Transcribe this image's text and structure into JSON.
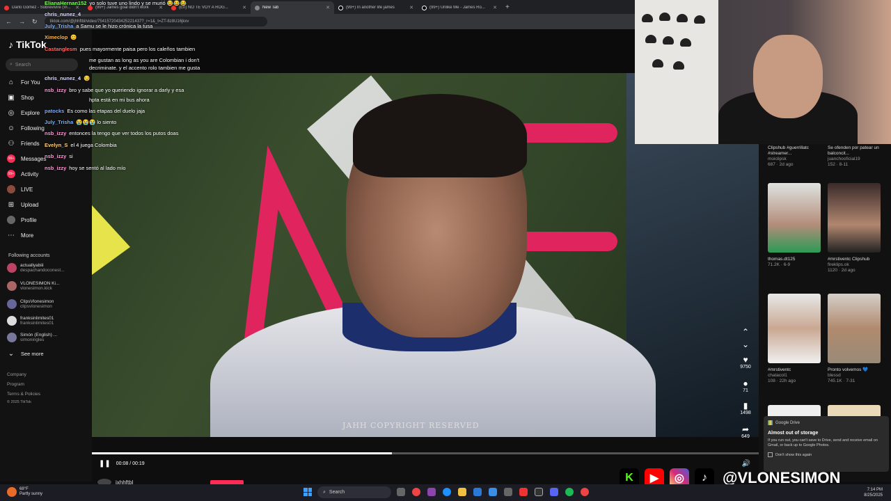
{
  "browser": {
    "tabs": [
      {
        "title": "Darlo Gómez - Sobrevivire (Vi...",
        "active": false
      },
      {
        "title": "(99+) James goal didn't work",
        "active": false
      },
      {
        "title": "(En) NO TE VOY A ROG...",
        "active": false
      },
      {
        "title": "New Tab",
        "active": true
      },
      {
        "title": "(99+) In another life james",
        "active": false
      },
      {
        "title": "(99+) Unlike Me - James Ro...",
        "active": false
      }
    ],
    "url": "tiktok.com/@jhhftbl/video/7541572043425221437?_r=1&_t=ZT-8z8U16jkxv"
  },
  "tiktok": {
    "logo": "TikTok",
    "search_placeholder": "Search",
    "nav": [
      {
        "label": "For You",
        "icon": "home-icon"
      },
      {
        "label": "Shop",
        "icon": "shop-icon"
      },
      {
        "label": "Explore",
        "icon": "compass-icon"
      },
      {
        "label": "Following",
        "icon": "following-icon"
      },
      {
        "label": "Friends",
        "icon": "friends-icon"
      },
      {
        "label": "Messages",
        "icon": "messages-icon",
        "badge": "99+"
      },
      {
        "label": "Activity",
        "icon": "activity-icon",
        "badge": "99+"
      },
      {
        "label": "LIVE",
        "icon": "live-icon"
      },
      {
        "label": "Upload",
        "icon": "upload-icon"
      },
      {
        "label": "Profile",
        "icon": "profile-icon"
      },
      {
        "label": "More",
        "icon": "more-icon"
      }
    ],
    "following_header": "Following accounts",
    "following": [
      {
        "name": "actuallyabiii",
        "handle": "despachandoconest..."
      },
      {
        "name": "VLONESIMON Ki...",
        "handle": "vlonesimon.kick"
      },
      {
        "name": "ClipsVlonesimon",
        "handle": "clipsvlonesimon"
      },
      {
        "name": "franksinlimites01",
        "handle": "franksinlimites01"
      },
      {
        "name": "Simón (English) ...",
        "handle": "simoningles"
      }
    ],
    "see_more": "See more",
    "footer": [
      "Company",
      "Program",
      "Terms & Policies",
      "© 2025 TikTok"
    ],
    "video": {
      "watermark": "JAHH COPYRIGHT RESERVED",
      "time": "00:08 / 00:19",
      "progress": 0.45,
      "author": "jxhhftbl"
    },
    "actions": [
      {
        "icon": "heart-icon",
        "count": "9750"
      },
      {
        "icon": "comment-icon",
        "count": "71"
      },
      {
        "icon": "bookmark-icon",
        "count": "1498"
      },
      {
        "icon": "share-icon",
        "count": "649"
      }
    ],
    "recommendations": [
      {
        "title": "Clipshub #guerrillatc #streamer...",
        "user": "moiclipsk",
        "stats": "687 · 2d ago"
      },
      {
        "title": "Se ofenden por patear un balconcit...",
        "user": "juanchooficial19",
        "stats": "152 · 8-11"
      },
      {
        "title": "thomas.dt125",
        "user": "",
        "stats": "71.2K · 6-9"
      },
      {
        "title": "#mrstiventc Clipshub",
        "user": "fireklips.ok",
        "stats": "1120 · 2d ago"
      },
      {
        "title": "#mrstiventc",
        "user": "chatacol1",
        "stats": "108 · 22h ago"
      },
      {
        "title": "Pronto volvemos 💙",
        "user": "blessd",
        "stats": "745.1K · 7-31"
      }
    ]
  },
  "chat": [
    {
      "user": "ElianaHernan152",
      "color": "#7fff5a",
      "text": "yo solo tuve uno lindo y se murió 😂😂😂"
    },
    {
      "user": "chris_nunez_4",
      "color": "#d9d9ff",
      "text": ""
    },
    {
      "user": "July_Trisha",
      "color": "#6fb2ff",
      "text": "a Samu se le hizo crónica la tusa"
    },
    {
      "user": "Ximeclop",
      "color": "#ffb347",
      "text": "😊"
    },
    {
      "user": "Castanglesm",
      "color": "#ff6b6b",
      "text": "pues mayormente paisa pero los caleños tambien"
    },
    {
      "user": "",
      "color": "#fff",
      "text": "me gustan as long as you are Colombian i don't"
    },
    {
      "user": "",
      "color": "#fff",
      "text": "decriminate. y el accento rolo tambien me gusta"
    },
    {
      "user": "chris_nunez_4",
      "color": "#d9d9ff",
      "text": "😏"
    },
    {
      "user": "nsb_izzy",
      "color": "#ff9bd6",
      "text": "bro y sabe que yo queriendo ignorar a darly y esa"
    },
    {
      "user": "",
      "color": "#fff",
      "text": "hpta está en mi bus ahora"
    },
    {
      "user": "patocks",
      "color": "#7ea7ff",
      "text": "Es como las etapas del duelo jaja"
    },
    {
      "user": "July_Trisha",
      "color": "#6fb2ff",
      "text": "😭😭😭 lo siento"
    },
    {
      "user": "nsb_izzy",
      "color": "#ff9bd6",
      "text": "entonces la tengo que ver todos los putos doas"
    },
    {
      "user": "Evelyn_S",
      "color": "#ffd27a",
      "text": "el 4 juega Colombia"
    },
    {
      "user": "nsb_izzy",
      "color": "#ff9bd6",
      "text": "si"
    },
    {
      "user": "nsb_izzy",
      "color": "#ff9bd6",
      "text": "hoy se sentó al lado mío"
    }
  ],
  "notification": {
    "app": "Google Drive",
    "title": "Almost out of storage",
    "body": "If you run out, you can't save to Drive, send and receive email on Gmail, or back up to Google Photos.",
    "checkbox": "Don't show this again"
  },
  "socials": {
    "handle": "@VLONESIMON",
    "icons": [
      "kick-icon",
      "youtube-icon",
      "instagram-icon",
      "tiktok-icon"
    ]
  },
  "taskbar": {
    "temp": "68°F",
    "weather": "Partly sunny",
    "search": "Search",
    "time": "7:14 PM",
    "date": "8/25/2025"
  },
  "colors": {
    "accent": "#fe2c55",
    "background": "#121212"
  }
}
